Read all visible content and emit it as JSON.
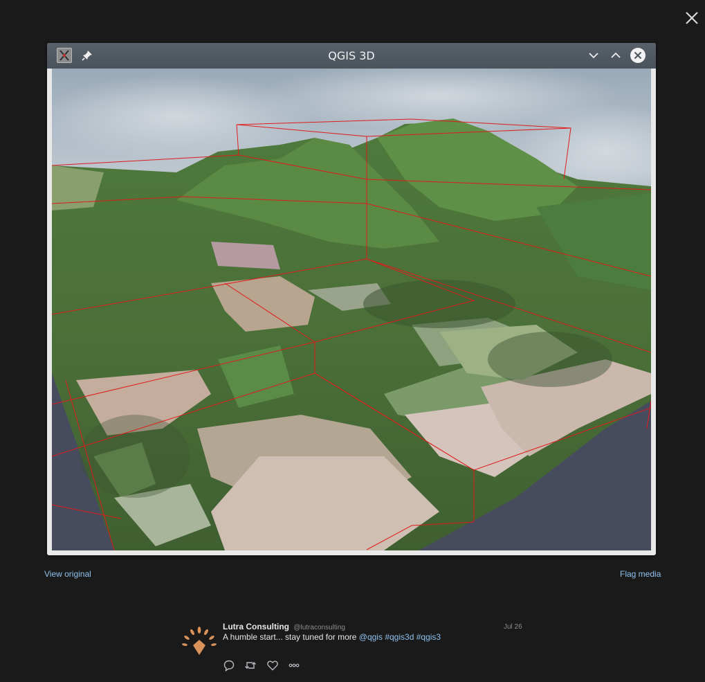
{
  "overlay": {
    "close_icon": "close-icon",
    "view_original": "View original",
    "flag_media": "Flag media"
  },
  "qgis_window": {
    "title": "QGIS 3D",
    "icons": [
      "qgis-app-icon",
      "pin-icon",
      "chevron-down-icon",
      "chevron-up-icon",
      "close-circle-icon"
    ]
  },
  "tweet": {
    "author_name": "Lutra Consulting",
    "author_handle": "@lutraconsulting",
    "date": "Jul 26",
    "text_prefix": "A humble start... stay tuned for more",
    "mentions": [
      "@qgis",
      "#qgis3d",
      "#qgis3"
    ],
    "actions": [
      "reply-icon",
      "retweet-icon",
      "like-icon",
      "more-icon"
    ]
  },
  "colors": {
    "background": "#1a1a1b",
    "link": "#8fc2ee",
    "titlebar": "#4f5860",
    "bounding_box": "#e01b1b",
    "avatar": "#d8925a"
  }
}
